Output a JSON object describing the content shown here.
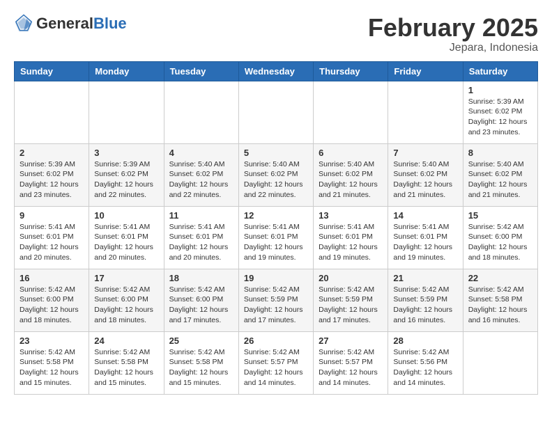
{
  "header": {
    "logo_general": "General",
    "logo_blue": "Blue",
    "month_title": "February 2025",
    "location": "Jepara, Indonesia"
  },
  "weekdays": [
    "Sunday",
    "Monday",
    "Tuesday",
    "Wednesday",
    "Thursday",
    "Friday",
    "Saturday"
  ],
  "weeks": [
    [
      {
        "day": "",
        "info": ""
      },
      {
        "day": "",
        "info": ""
      },
      {
        "day": "",
        "info": ""
      },
      {
        "day": "",
        "info": ""
      },
      {
        "day": "",
        "info": ""
      },
      {
        "day": "",
        "info": ""
      },
      {
        "day": "1",
        "info": "Sunrise: 5:39 AM\nSunset: 6:02 PM\nDaylight: 12 hours\nand 23 minutes."
      }
    ],
    [
      {
        "day": "2",
        "info": "Sunrise: 5:39 AM\nSunset: 6:02 PM\nDaylight: 12 hours\nand 23 minutes."
      },
      {
        "day": "3",
        "info": "Sunrise: 5:39 AM\nSunset: 6:02 PM\nDaylight: 12 hours\nand 22 minutes."
      },
      {
        "day": "4",
        "info": "Sunrise: 5:40 AM\nSunset: 6:02 PM\nDaylight: 12 hours\nand 22 minutes."
      },
      {
        "day": "5",
        "info": "Sunrise: 5:40 AM\nSunset: 6:02 PM\nDaylight: 12 hours\nand 22 minutes."
      },
      {
        "day": "6",
        "info": "Sunrise: 5:40 AM\nSunset: 6:02 PM\nDaylight: 12 hours\nand 21 minutes."
      },
      {
        "day": "7",
        "info": "Sunrise: 5:40 AM\nSunset: 6:02 PM\nDaylight: 12 hours\nand 21 minutes."
      },
      {
        "day": "8",
        "info": "Sunrise: 5:40 AM\nSunset: 6:02 PM\nDaylight: 12 hours\nand 21 minutes."
      }
    ],
    [
      {
        "day": "9",
        "info": "Sunrise: 5:41 AM\nSunset: 6:01 PM\nDaylight: 12 hours\nand 20 minutes."
      },
      {
        "day": "10",
        "info": "Sunrise: 5:41 AM\nSunset: 6:01 PM\nDaylight: 12 hours\nand 20 minutes."
      },
      {
        "day": "11",
        "info": "Sunrise: 5:41 AM\nSunset: 6:01 PM\nDaylight: 12 hours\nand 20 minutes."
      },
      {
        "day": "12",
        "info": "Sunrise: 5:41 AM\nSunset: 6:01 PM\nDaylight: 12 hours\nand 19 minutes."
      },
      {
        "day": "13",
        "info": "Sunrise: 5:41 AM\nSunset: 6:01 PM\nDaylight: 12 hours\nand 19 minutes."
      },
      {
        "day": "14",
        "info": "Sunrise: 5:41 AM\nSunset: 6:01 PM\nDaylight: 12 hours\nand 19 minutes."
      },
      {
        "day": "15",
        "info": "Sunrise: 5:42 AM\nSunset: 6:00 PM\nDaylight: 12 hours\nand 18 minutes."
      }
    ],
    [
      {
        "day": "16",
        "info": "Sunrise: 5:42 AM\nSunset: 6:00 PM\nDaylight: 12 hours\nand 18 minutes."
      },
      {
        "day": "17",
        "info": "Sunrise: 5:42 AM\nSunset: 6:00 PM\nDaylight: 12 hours\nand 18 minutes."
      },
      {
        "day": "18",
        "info": "Sunrise: 5:42 AM\nSunset: 6:00 PM\nDaylight: 12 hours\nand 17 minutes."
      },
      {
        "day": "19",
        "info": "Sunrise: 5:42 AM\nSunset: 5:59 PM\nDaylight: 12 hours\nand 17 minutes."
      },
      {
        "day": "20",
        "info": "Sunrise: 5:42 AM\nSunset: 5:59 PM\nDaylight: 12 hours\nand 17 minutes."
      },
      {
        "day": "21",
        "info": "Sunrise: 5:42 AM\nSunset: 5:59 PM\nDaylight: 12 hours\nand 16 minutes."
      },
      {
        "day": "22",
        "info": "Sunrise: 5:42 AM\nSunset: 5:58 PM\nDaylight: 12 hours\nand 16 minutes."
      }
    ],
    [
      {
        "day": "23",
        "info": "Sunrise: 5:42 AM\nSunset: 5:58 PM\nDaylight: 12 hours\nand 15 minutes."
      },
      {
        "day": "24",
        "info": "Sunrise: 5:42 AM\nSunset: 5:58 PM\nDaylight: 12 hours\nand 15 minutes."
      },
      {
        "day": "25",
        "info": "Sunrise: 5:42 AM\nSunset: 5:58 PM\nDaylight: 12 hours\nand 15 minutes."
      },
      {
        "day": "26",
        "info": "Sunrise: 5:42 AM\nSunset: 5:57 PM\nDaylight: 12 hours\nand 14 minutes."
      },
      {
        "day": "27",
        "info": "Sunrise: 5:42 AM\nSunset: 5:57 PM\nDaylight: 12 hours\nand 14 minutes."
      },
      {
        "day": "28",
        "info": "Sunrise: 5:42 AM\nSunset: 5:56 PM\nDaylight: 12 hours\nand 14 minutes."
      },
      {
        "day": "",
        "info": ""
      }
    ]
  ]
}
